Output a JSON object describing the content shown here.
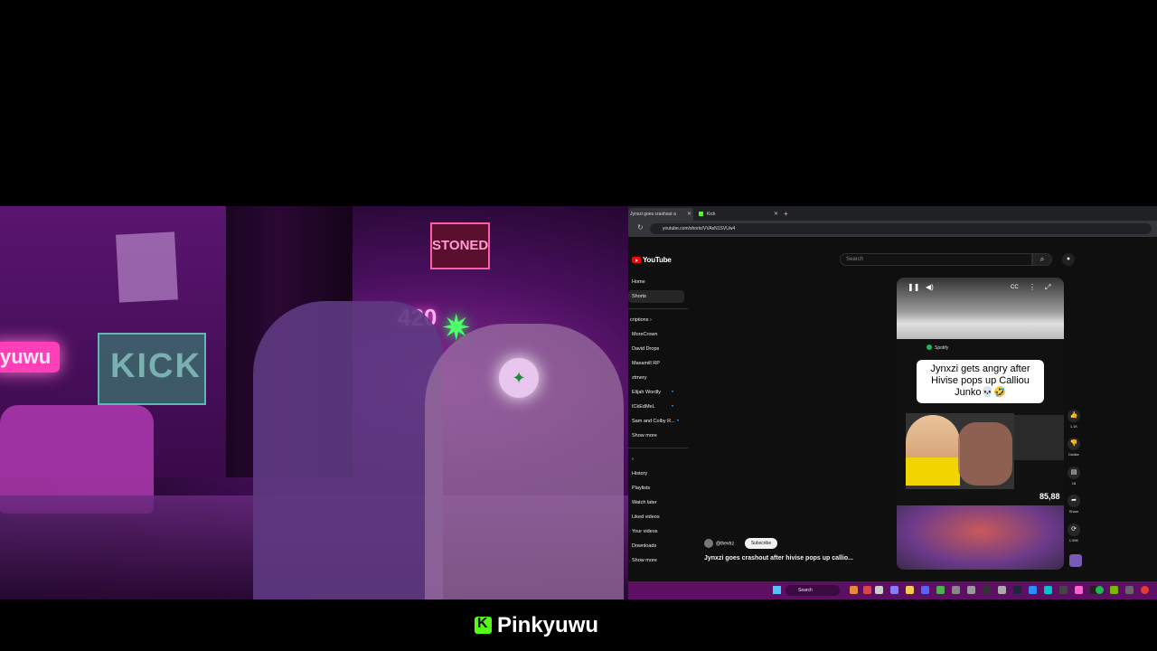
{
  "streamer": {
    "name": "Pinkyuwu"
  },
  "webcam": {
    "kick_sign": "KICK",
    "neon_name": "yuwu",
    "stoned_sign": "STONED",
    "neon_420": "420"
  },
  "browser": {
    "tabs": [
      {
        "title": "Jynxzi goes crashout a",
        "active": true
      },
      {
        "title": "Kick",
        "active": false
      }
    ],
    "new_tab": "+",
    "url": "youtube.com/shorts/VVAsN1SVUw4"
  },
  "youtube": {
    "logo_text": "YouTube",
    "search_placeholder": "Search",
    "nav_primary": [
      {
        "label": "Home",
        "active": false
      },
      {
        "label": "Shorts",
        "active": true
      }
    ],
    "subscriptions_header": "criptions",
    "subscriptions": [
      {
        "label": "MoreCrown",
        "live": false
      },
      {
        "label": "David Drops",
        "live": false
      },
      {
        "label": "Maxamill RP",
        "live": false
      },
      {
        "label": "ztmery",
        "live": false
      },
      {
        "label": "Elijah Wordly",
        "live": true
      },
      {
        "label": "ICkEdMeL",
        "live": true
      },
      {
        "label": "Sam and Colby R...",
        "live": true
      },
      {
        "label": "Show more",
        "live": false
      }
    ],
    "you_section": [
      {
        "label": "History"
      },
      {
        "label": "Playlists"
      },
      {
        "label": "Watch later"
      },
      {
        "label": "Liked videos"
      },
      {
        "label": "Your videos"
      },
      {
        "label": "Downloads"
      },
      {
        "label": "Show more"
      }
    ],
    "short": {
      "spotify_label": "Spotify",
      "caption": "Jynxzi gets angry after Hivise pops up Calliou Junko💀🤣",
      "view_counter": "85,88",
      "channel": "@thevtrz",
      "subscribe_label": "Subscribe",
      "title": "Jynxzi goes crashout after hivise pops up callio..."
    },
    "actions": [
      {
        "icon": "like-icon",
        "label": "1.1K"
      },
      {
        "icon": "dislike-icon",
        "label": "Dislike"
      },
      {
        "icon": "comment-icon",
        "label": "18"
      },
      {
        "icon": "share-icon",
        "label": "Share"
      },
      {
        "icon": "remix-icon",
        "label": "1.55K"
      }
    ]
  },
  "taskbar": {
    "search_label": "Search"
  },
  "colors": {
    "kick_green": "#53fc18",
    "yt_red": "#ff0000",
    "taskbar": "#5d0f63"
  }
}
